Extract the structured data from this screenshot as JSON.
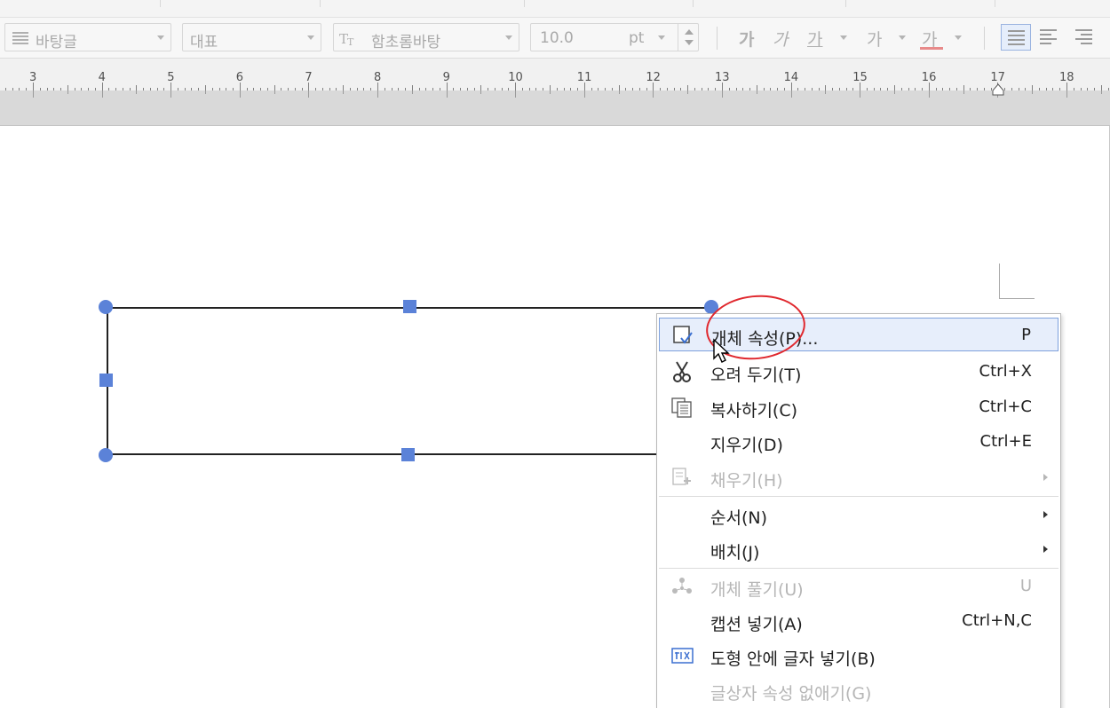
{
  "toolbar": {
    "style_combo": "바탕글",
    "lang_combo": "대표",
    "font_combo": "함초롬바탕",
    "font_size": "10.0",
    "font_unit": "pt",
    "bold_glyph": "가",
    "italic_glyph": "가",
    "underline_glyph": "가",
    "strike_glyph": "가",
    "color_glyph": "가"
  },
  "ruler": {
    "labels": [
      "3",
      "4",
      "5",
      "6",
      "7",
      "8",
      "9",
      "10",
      "11",
      "12",
      "13",
      "14",
      "15",
      "16",
      "17",
      "18"
    ]
  },
  "context_menu": {
    "items": [
      {
        "label": "개체 속성(P)...",
        "shortcut": "P",
        "icon": "object-properties-icon",
        "state": "highlighted"
      },
      {
        "label": "오려 두기(T)",
        "shortcut": "Ctrl+X",
        "icon": "scissors-icon",
        "state": "enabled"
      },
      {
        "label": "복사하기(C)",
        "shortcut": "Ctrl+C",
        "icon": "copy-icon",
        "state": "enabled"
      },
      {
        "label": "지우기(D)",
        "shortcut": "Ctrl+E",
        "icon": "",
        "state": "enabled"
      },
      {
        "label": "채우기(H)",
        "shortcut": "",
        "icon": "fill-icon",
        "state": "disabled",
        "submenu": true
      },
      {
        "label": "순서(N)",
        "shortcut": "",
        "icon": "",
        "state": "enabled",
        "submenu": true
      },
      {
        "label": "배치(J)",
        "shortcut": "",
        "icon": "",
        "state": "enabled",
        "submenu": true
      },
      {
        "label": "개체 풀기(U)",
        "shortcut": "U",
        "icon": "ungroup-icon",
        "state": "disabled"
      },
      {
        "label": "캡션 넣기(A)",
        "shortcut": "Ctrl+N,C",
        "icon": "",
        "state": "enabled"
      },
      {
        "label": "도형 안에 글자 넣기(B)",
        "shortcut": "",
        "icon": "text-in-shape-icon",
        "state": "enabled"
      },
      {
        "label": "글상자 속성 없애기(G)",
        "shortcut": "",
        "icon": "",
        "state": "disabled"
      }
    ]
  },
  "colors": {
    "selection_handle": "#5b82d8",
    "menu_highlight": "#e7eefb",
    "annotation_circle": "#e0282e"
  }
}
